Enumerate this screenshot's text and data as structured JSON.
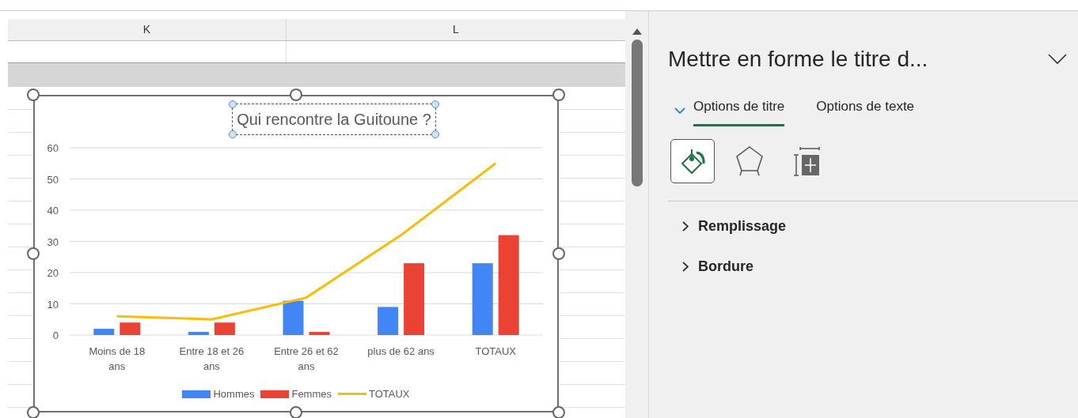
{
  "spreadsheet": {
    "columns": [
      {
        "label": "K"
      },
      {
        "label": "L"
      }
    ]
  },
  "chart": {
    "selected": true,
    "title": "Qui rencontre la Guitoune ?",
    "title_selected": true,
    "chart_data": {
      "type": "bar",
      "grid": true,
      "categories": [
        "Moins de 18 ans",
        "Entre 18 et 26 ans",
        "Entre 26 et 62 ans",
        "plus de 62 ans",
        "TOTAUX"
      ],
      "ylim": [
        0,
        60
      ],
      "yticks": [
        0,
        10,
        20,
        30,
        40,
        50,
        60
      ],
      "series": [
        {
          "name": "Hommes",
          "color": "#4285f4",
          "values": [
            2,
            1,
            11,
            9,
            23
          ]
        },
        {
          "name": "Femmes",
          "color": "#ea4335",
          "values": [
            4,
            4,
            1,
            23,
            32
          ]
        },
        {
          "name": "TOTAUX",
          "color": "#fbbc04",
          "type": "line",
          "values": [
            6,
            5,
            12,
            32,
            55
          ]
        }
      ]
    }
  },
  "format_pane": {
    "title": "Mettre en forme le titre d...",
    "tabs": [
      {
        "label": "Options de titre",
        "selected": true
      },
      {
        "label": "Options de texte",
        "selected": false
      }
    ],
    "icon_tabs": [
      {
        "kind": "fill",
        "selected": true
      },
      {
        "kind": "shape",
        "selected": false
      },
      {
        "kind": "size",
        "selected": false
      }
    ],
    "sections": [
      {
        "label": "Remplissage",
        "expanded": false
      },
      {
        "label": "Bordure",
        "expanded": false
      }
    ]
  }
}
